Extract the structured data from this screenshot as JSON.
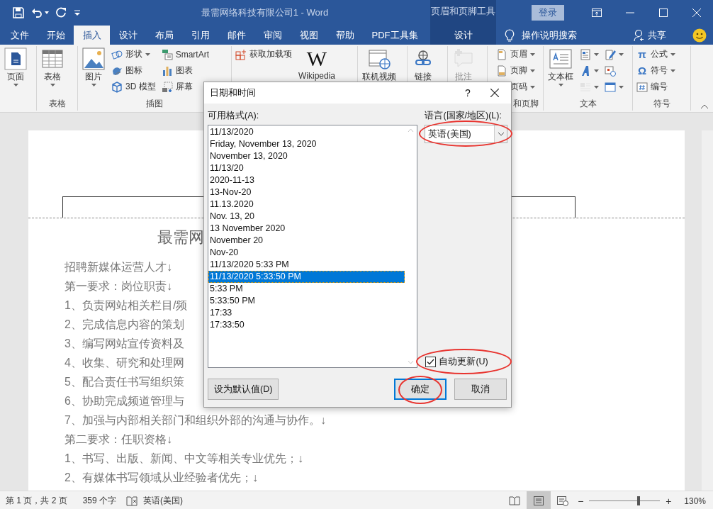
{
  "window": {
    "title": "最需网络科技有限公司1  -  Word",
    "contextual_group": "页眉和页脚工具",
    "sign_in": "登录"
  },
  "tabs": [
    {
      "label": "文件",
      "selected": false,
      "kind": "normal"
    },
    {
      "label": "开始",
      "selected": false,
      "kind": "normal"
    },
    {
      "label": "插入",
      "selected": true,
      "kind": "normal"
    },
    {
      "label": "设计",
      "selected": false,
      "kind": "normal"
    },
    {
      "label": "布局",
      "selected": false,
      "kind": "normal"
    },
    {
      "label": "引用",
      "selected": false,
      "kind": "normal"
    },
    {
      "label": "邮件",
      "selected": false,
      "kind": "normal"
    },
    {
      "label": "审阅",
      "selected": false,
      "kind": "normal"
    },
    {
      "label": "视图",
      "selected": false,
      "kind": "normal"
    },
    {
      "label": "帮助",
      "selected": false,
      "kind": "normal"
    },
    {
      "label": "PDF工具集",
      "selected": false,
      "kind": "normal"
    },
    {
      "label": "设计",
      "selected": false,
      "kind": "contextual"
    }
  ],
  "tell_me": "操作说明搜索",
  "share": "共享",
  "ribbon": [
    {
      "items": [
        {
          "label": "页面",
          "kind": "large",
          "dropdown": true,
          "disabled": false
        }
      ]
    },
    {
      "label": "表格",
      "items": [
        {
          "label": "表格",
          "kind": "large",
          "dropdown": true,
          "disabled": false
        }
      ]
    },
    {
      "label": "插图",
      "items": [
        {
          "label": "图片",
          "kind": "large",
          "dropdown": true,
          "disabled": false
        },
        {
          "label": "形状",
          "kind": "small",
          "dropdown": true,
          "disabled": false
        },
        {
          "label": "图标",
          "kind": "small",
          "dropdown": false,
          "disabled": false
        },
        {
          "label": "3D 模型",
          "kind": "small",
          "dropdown": false,
          "disabled": false
        },
        {
          "label": "SmartArt",
          "kind": "small",
          "dropdown": false,
          "disabled": false
        },
        {
          "label": "图表",
          "kind": "small",
          "dropdown": false,
          "disabled": false
        },
        {
          "label": "屏幕",
          "kind": "small",
          "dropdown": false,
          "disabled": false
        }
      ]
    },
    {
      "items": [
        {
          "label": "获取加载项",
          "kind": "small",
          "dropdown": false,
          "disabled": false
        },
        {
          "label": "Wikipedia",
          "kind": "large",
          "glyph": "W",
          "dropdown": false,
          "disabled": false
        }
      ]
    },
    {
      "items": [
        {
          "label": "联机视频",
          "kind": "large",
          "dropdown": false,
          "disabled": false
        }
      ]
    },
    {
      "items": [
        {
          "label": "链接",
          "kind": "large",
          "dropdown": false,
          "disabled": false
        }
      ]
    },
    {
      "items": [
        {
          "label": "批注",
          "kind": "large",
          "dropdown": false,
          "disabled": true
        }
      ]
    },
    {
      "label": "和页脚",
      "items": [
        {
          "label": "页眉",
          "kind": "small",
          "dropdown": true,
          "disabled": false
        },
        {
          "label": "页脚",
          "kind": "small",
          "dropdown": true,
          "disabled": false
        },
        {
          "label": "页码",
          "kind": "small",
          "dropdown": true,
          "disabled": false
        }
      ]
    },
    {
      "label": "文本",
      "items": [
        {
          "label": "文本框",
          "kind": "large",
          "dropdown": true,
          "disabled": false
        },
        {
          "kind": "icon",
          "dropdown": true,
          "disabled": false
        },
        {
          "kind": "icon",
          "dropdown": true,
          "disabled": false
        },
        {
          "kind": "icon",
          "dropdown": true,
          "disabled": true
        },
        {
          "kind": "icon",
          "dropdown": true,
          "disabled": false
        },
        {
          "kind": "icon",
          "dropdown": false,
          "disabled": false
        },
        {
          "kind": "icon",
          "dropdown": true,
          "disabled": false
        }
      ]
    },
    {
      "label": "符号",
      "items": [
        {
          "label": "公式",
          "kind": "small",
          "glyph": "π",
          "dropdown": true,
          "disabled": false
        },
        {
          "label": "符号",
          "kind": "small",
          "glyph": "Ω",
          "dropdown": true,
          "disabled": false
        },
        {
          "label": "编号",
          "kind": "small",
          "dropdown": false,
          "disabled": false
        }
      ]
    }
  ],
  "document": {
    "title": "最需网",
    "lines": [
      "招聘新媒体运营人才↓",
      "第一要求：岗位职责↓",
      "1、负责网站相关栏目/频",
      "2、完成信息内容的策划",
      "3、编写网站宣传资料及",
      "4、收集、研究和处理网",
      "5、配合责任书写组织策",
      "6、协助完成频道管理与",
      "7、加强与内部相关部门和组织外部的沟通与协作。↓",
      "第二要求：任职资格↓",
      "1、书写、出版、新闻、中文等相关专业优先；↓",
      "2、有媒体书写领域从业经验者优先；↓"
    ]
  },
  "dialog": {
    "title": "日期和时间",
    "help": "?",
    "formats_label": "可用格式(A):",
    "formats": [
      {
        "text": "11/13/2020",
        "selected": false
      },
      {
        "text": "Friday, November 13, 2020",
        "selected": false
      },
      {
        "text": "November 13, 2020",
        "selected": false
      },
      {
        "text": "11/13/20",
        "selected": false
      },
      {
        "text": "2020-11-13",
        "selected": false
      },
      {
        "text": "13-Nov-20",
        "selected": false
      },
      {
        "text": "11.13.2020",
        "selected": false
      },
      {
        "text": "Nov. 13, 20",
        "selected": false
      },
      {
        "text": "13 November 2020",
        "selected": false
      },
      {
        "text": "November 20",
        "selected": false
      },
      {
        "text": "Nov-20",
        "selected": false
      },
      {
        "text": "11/13/2020 5:33 PM",
        "selected": false
      },
      {
        "text": "11/13/2020 5:33:50 PM",
        "selected": true
      },
      {
        "text": "5:33 PM",
        "selected": false
      },
      {
        "text": "5:33:50 PM",
        "selected": false
      },
      {
        "text": "17:33",
        "selected": false
      },
      {
        "text": "17:33:50",
        "selected": false
      }
    ],
    "language_label": "语言(国家/地区)(L):",
    "language": {
      "value": "英语(美国)",
      "highlighted": true
    },
    "auto_update": {
      "label": "自动更新(U)",
      "checked": true,
      "highlighted": true
    },
    "buttons": [
      {
        "label": "设为默认值(D)",
        "kind": "normal",
        "highlighted": false
      },
      {
        "label": "确定",
        "kind": "default",
        "highlighted": true
      },
      {
        "label": "取消",
        "kind": "normal",
        "highlighted": false
      }
    ]
  },
  "status_bar": {
    "page": "第 1 页，共 2 页",
    "words": "359 个字",
    "language": "英语(美国)",
    "views": [
      {
        "selected": false
      },
      {
        "selected": true
      },
      {
        "selected": false
      }
    ],
    "zoom_minus": "−",
    "zoom_plus": "+",
    "zoom": {
      "level": 0.7
    },
    "zoom_text": "130%"
  }
}
